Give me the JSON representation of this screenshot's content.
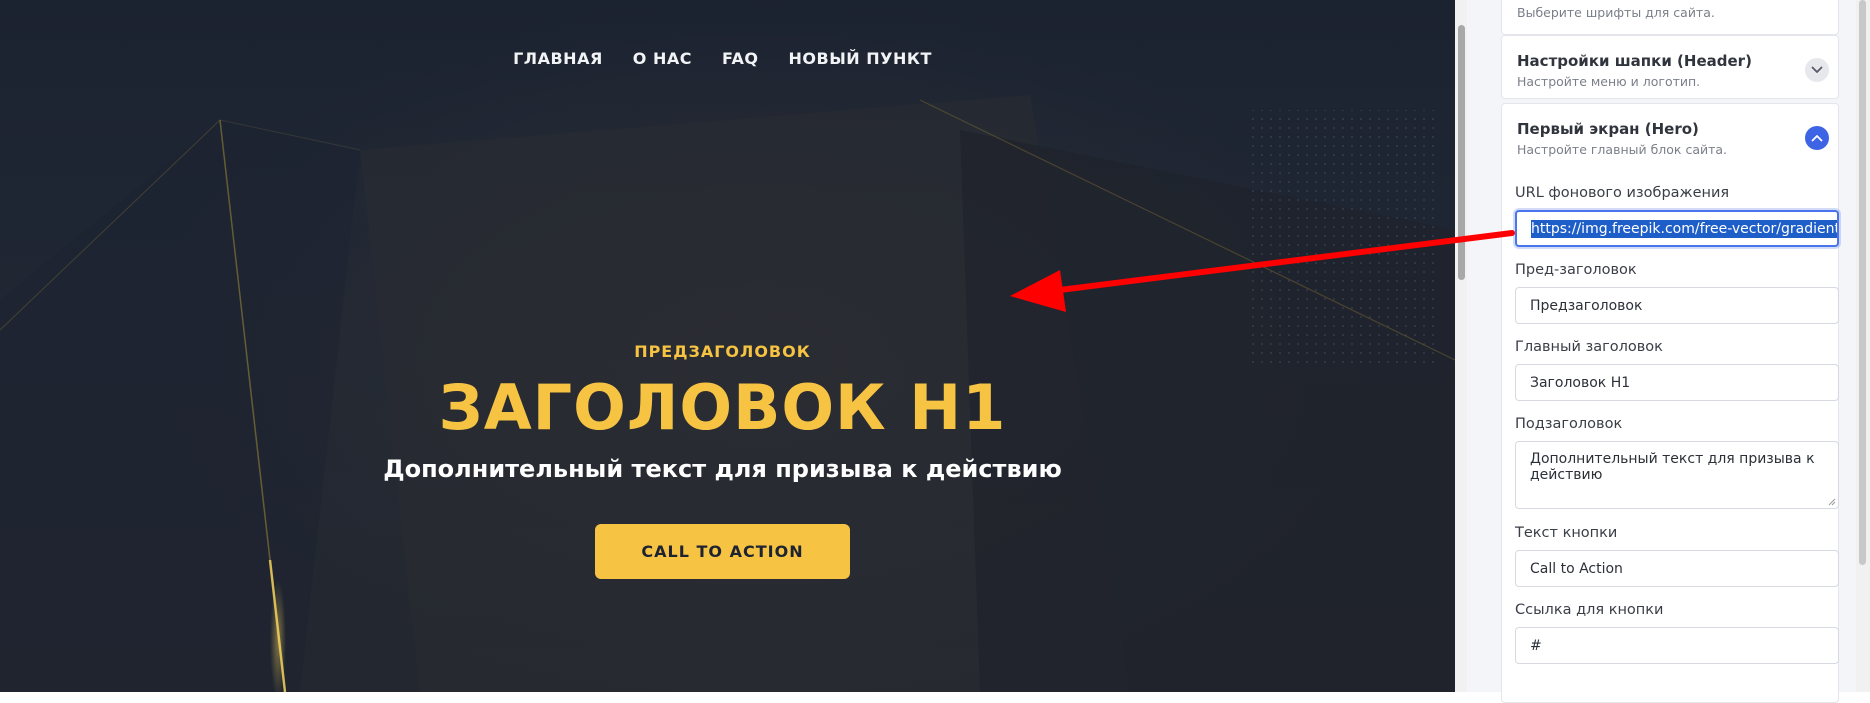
{
  "preview": {
    "nav": [
      {
        "label": "ГЛАВНАЯ"
      },
      {
        "label": "О НАС"
      },
      {
        "label": "FAQ"
      },
      {
        "label": "НОВЫЙ ПУНКТ"
      }
    ],
    "hero": {
      "pre_title": "ПРЕДЗАГОЛОВОК",
      "title": "ЗАГОЛОВОК H1",
      "subtitle": "Дополнительный текст для призыва к действию",
      "button": "CALL TO ACTION"
    }
  },
  "panel": {
    "fonts_card": {
      "desc": "Выберите шрифты для сайта."
    },
    "header_card": {
      "title": "Настройки шапки (Header)",
      "desc": "Настройте меню и логотип."
    },
    "hero_card": {
      "title": "Первый экран (Hero)",
      "desc": "Настройте главный блок сайта.",
      "fields": {
        "bg_url": {
          "label": "URL фонового изображения",
          "value": "https://img.freepik.com/free-vector/gradient"
        },
        "pre_title": {
          "label": "Пред-заголовок",
          "value": "Предзаголовок"
        },
        "title": {
          "label": "Главный заголовок",
          "value": "Заголовок H1"
        },
        "subtitle": {
          "label": "Подзаголовок",
          "value": "Дополнительный текст для призыва к действию"
        },
        "button_text": {
          "label": "Текст кнопки",
          "value": "Call to Action"
        },
        "button_link": {
          "label": "Ссылка для кнопки",
          "value": "#"
        }
      }
    }
  },
  "colors": {
    "accent_yellow": "#f6c343",
    "hero_bg": "#1f2633",
    "focus_blue": "#4a74e9",
    "toggle_blue": "#3d64e4",
    "arrow_red": "#ff0000"
  },
  "icons": [
    "chevron-down-icon",
    "chevron-up-icon",
    "red-arrow-annotation"
  ]
}
